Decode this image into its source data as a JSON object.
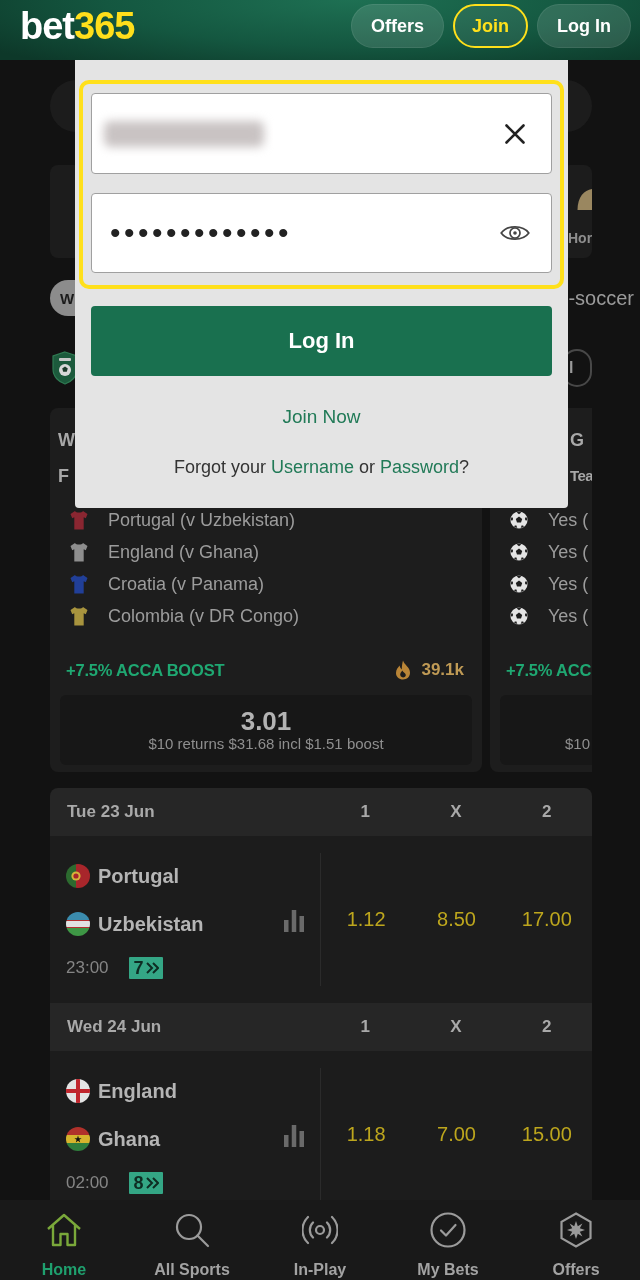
{
  "header": {
    "logo": {
      "word": "bet",
      "number": "365"
    },
    "buttons": [
      {
        "label": "Offers",
        "kind": "pill"
      },
      {
        "label": "Join",
        "kind": "outlined"
      },
      {
        "label": "Log In",
        "kind": "pill"
      }
    ]
  },
  "login_form": {
    "password": {
      "value": "•••••••••••••"
    },
    "submit_button": "Log In",
    "join_link": "Join Now",
    "forgot": {
      "prefix": "Forgot your",
      "username_link": "Username",
      "middle": "or",
      "password_link": "Password",
      "suffix": "?"
    }
  },
  "sport_tile": {
    "label": "Hor"
  },
  "chip_row": {
    "chip": {
      "label": "W",
      "selected": true
    },
    "link_fragment": "-soccer"
  },
  "competition_row": {
    "button_fragment": "l"
  },
  "bet_cards": [
    {
      "title_fragment": "W",
      "subtitle_fragment": "F",
      "selections": [
        {
          "kind": "shirt",
          "label": "Portugal (v Uzbekistan)",
          "color": "#8a2631"
        },
        {
          "kind": "shirt",
          "label": "England (v Ghana)",
          "color": "#8e8e8e"
        },
        {
          "kind": "shirt",
          "label": "Croatia (v Panama)",
          "color": "#213f98"
        },
        {
          "kind": "shirt",
          "label": "Colombia (v DR Congo)",
          "color": "#a8943e"
        }
      ],
      "boost": "+7.5% ACCA BOOST",
      "popularity": "39.1k",
      "odds": "3.01",
      "returns": "$10 returns $31.68 incl $1.51 boost"
    },
    {
      "title_fragment": "G",
      "subtitle_fragment": "Tea",
      "selections": [
        {
          "kind": "ball",
          "label": "Yes ("
        },
        {
          "kind": "ball",
          "label": "Yes ("
        },
        {
          "kind": "ball",
          "label": "Yes ("
        },
        {
          "kind": "ball",
          "label": "Yes ("
        }
      ],
      "boost": "+7.5% ACC",
      "returns": "$10"
    }
  ],
  "match_groups": [
    {
      "date": "Tue 23 Jun",
      "columns": [
        "1",
        "X",
        "2"
      ],
      "matches": [
        {
          "teams": [
            "Portugal",
            "Uzbekistan"
          ],
          "time": "23:00",
          "more_markets": "7",
          "odds": [
            "1.12",
            "8.50",
            "17.00"
          ]
        }
      ]
    },
    {
      "date": "Wed 24 Jun",
      "columns": [
        "1",
        "X",
        "2"
      ],
      "matches": [
        {
          "teams": [
            "England",
            "Ghana"
          ],
          "time": "02:00",
          "more_markets": "8",
          "odds": [
            "1.18",
            "7.00",
            "15.00"
          ]
        }
      ]
    }
  ],
  "bottom_nav": [
    {
      "label": "Home",
      "selected": true
    },
    {
      "label": "All Sports",
      "selected": false
    },
    {
      "label": "In-Play",
      "selected": false
    },
    {
      "label": "My Bets",
      "selected": false
    },
    {
      "label": "Offers",
      "selected": false
    }
  ]
}
